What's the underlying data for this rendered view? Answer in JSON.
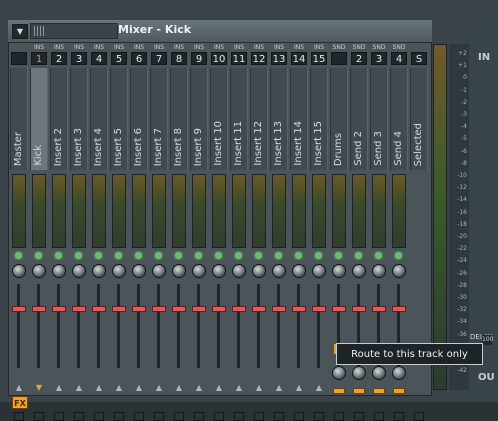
{
  "window": {
    "title": "Mixer - Kick",
    "menu_icon": "menu-icon"
  },
  "tracks": [
    {
      "ins": "",
      "num": "",
      "name": "Master"
    },
    {
      "ins": "INS",
      "num": "1",
      "name": "Kick"
    },
    {
      "ins": "INS",
      "num": "2",
      "name": "Insert 2"
    },
    {
      "ins": "INS",
      "num": "3",
      "name": "Insert 3"
    },
    {
      "ins": "INS",
      "num": "4",
      "name": "Insert 4"
    },
    {
      "ins": "INS",
      "num": "5",
      "name": "Insert 5"
    },
    {
      "ins": "INS",
      "num": "6",
      "name": "Insert 6"
    },
    {
      "ins": "INS",
      "num": "7",
      "name": "Insert 7"
    },
    {
      "ins": "INS",
      "num": "8",
      "name": "Insert 8"
    },
    {
      "ins": "INS",
      "num": "9",
      "name": "Insert 9"
    },
    {
      "ins": "INS",
      "num": "10",
      "name": "Insert 10"
    },
    {
      "ins": "INS",
      "num": "11",
      "name": "Insert 11"
    },
    {
      "ins": "INS",
      "num": "12",
      "name": "Insert 12"
    },
    {
      "ins": "INS",
      "num": "13",
      "name": "Insert 13"
    },
    {
      "ins": "INS",
      "num": "14",
      "name": "Insert 14"
    },
    {
      "ins": "INS",
      "num": "15",
      "name": "Insert 15"
    },
    {
      "ins": "SND",
      "num": "",
      "name": "Drums"
    },
    {
      "ins": "SND",
      "num": "2",
      "name": "Send 2"
    },
    {
      "ins": "SND",
      "num": "3",
      "name": "Send 3"
    },
    {
      "ins": "SND",
      "num": "4",
      "name": "Send 4"
    },
    {
      "ins": "",
      "num": "S",
      "name": "Selected"
    }
  ],
  "fx_label": "FX",
  "tooltip": "Route to this track only",
  "right_panel": {
    "top": "IN",
    "delay_label": "DELAY",
    "delay_value": "100",
    "bottom": "OU"
  },
  "scale_labels": [
    "+2",
    "+1",
    "0",
    "-1",
    "-2",
    "-3",
    "-4",
    "-5",
    "-6",
    "-8",
    "-10",
    "-12",
    "-14",
    "-16",
    "-18",
    "-20",
    "-22",
    "-24",
    "-26",
    "-28",
    "-30",
    "-32",
    "-34",
    "-36",
    "-38",
    "-40",
    "-42"
  ]
}
